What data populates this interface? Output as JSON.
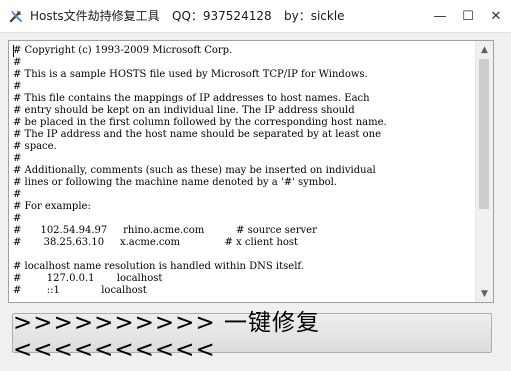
{
  "titlebar": {
    "app_name": "Hosts文件劫持修复工具",
    "qq": "QQ：937524128",
    "author": "by：sickle",
    "icon": "tools-icon"
  },
  "window_controls": {
    "minimize": "—",
    "maximize": "☐",
    "close": "✕"
  },
  "editor": {
    "lines": [
      "# Copyright (c) 1993-2009 Microsoft Corp.",
      "#",
      "# This is a sample HOSTS file used by Microsoft TCP/IP for Windows.",
      "#",
      "# This file contains the mappings of IP addresses to host names. Each",
      "# entry should be kept on an individual line. The IP address should",
      "# be placed in the first column followed by the corresponding host name.",
      "# The IP address and the host name should be separated by at least one",
      "# space.",
      "#",
      "# Additionally, comments (such as these) may be inserted on individual",
      "# lines or following the machine name denoted by a '#' symbol.",
      "#",
      "# For example:",
      "#",
      "#      102.54.94.97     rhino.acme.com          # source server",
      "#       38.25.63.10     x.acme.com              # x client host",
      "",
      "# localhost name resolution is handled within DNS itself.",
      "#\t127.0.0.1       localhost",
      "#\t::1             localhost"
    ]
  },
  "fix_button": {
    "label": ">>>>>>>>>> 一键修复 <<<<<<<<<<"
  },
  "scrollbar": {
    "up": "▲",
    "down": "▼"
  }
}
